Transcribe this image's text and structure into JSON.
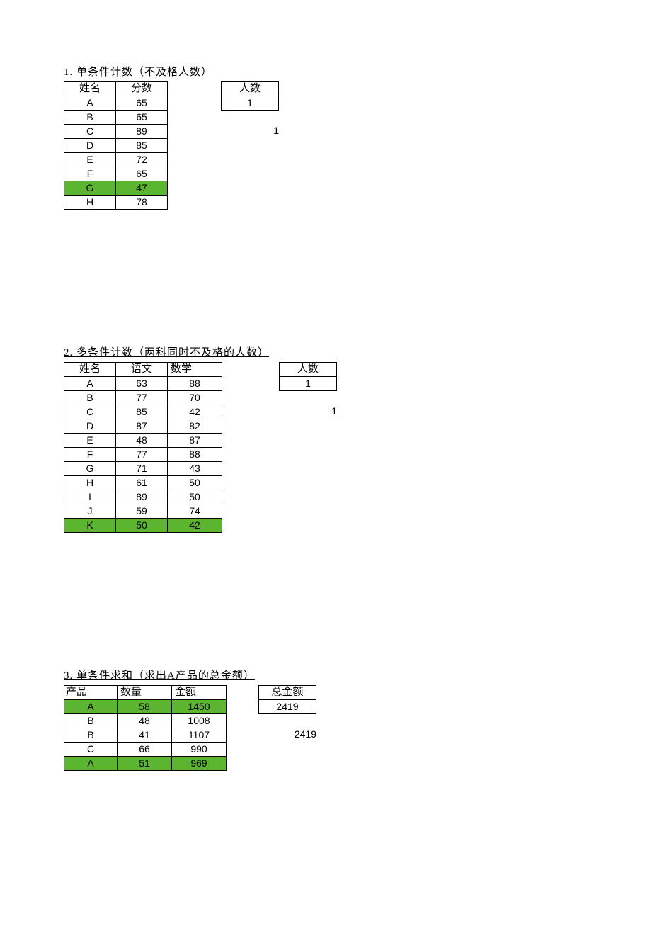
{
  "section1": {
    "title": "1. 单条件计数（不及格人数）",
    "headers": [
      "姓名",
      "分数"
    ],
    "rows": [
      {
        "name": "A",
        "score": "65",
        "hl": false
      },
      {
        "name": "B",
        "score": "65",
        "hl": false
      },
      {
        "name": "C",
        "score": "89",
        "hl": false
      },
      {
        "name": "D",
        "score": "85",
        "hl": false
      },
      {
        "name": "E",
        "score": "72",
        "hl": false
      },
      {
        "name": "F",
        "score": "65",
        "hl": false
      },
      {
        "name": "G",
        "score": "47",
        "hl": true
      },
      {
        "name": "H",
        "score": "78",
        "hl": false
      }
    ],
    "result_header": "人数",
    "result_value": "1",
    "below_value": "1"
  },
  "section2": {
    "title": "2. 多条件计数（两科同时不及格的人数）",
    "headers": [
      "姓名",
      "语文",
      "数学"
    ],
    "rows": [
      {
        "name": "A",
        "yw": "63",
        "sx": "88",
        "hl": false
      },
      {
        "name": "B",
        "yw": "77",
        "sx": "70",
        "hl": false
      },
      {
        "name": "C",
        "yw": "85",
        "sx": "42",
        "hl": false
      },
      {
        "name": "D",
        "yw": "87",
        "sx": "82",
        "hl": false
      },
      {
        "name": "E",
        "yw": "48",
        "sx": "87",
        "hl": false
      },
      {
        "name": "F",
        "yw": "77",
        "sx": "88",
        "hl": false
      },
      {
        "name": "G",
        "yw": "71",
        "sx": "43",
        "hl": false
      },
      {
        "name": "H",
        "yw": "61",
        "sx": "50",
        "hl": false
      },
      {
        "name": "I",
        "yw": "89",
        "sx": "50",
        "hl": false
      },
      {
        "name": "J",
        "yw": "59",
        "sx": "74",
        "hl": false
      },
      {
        "name": "K",
        "yw": "50",
        "sx": "42",
        "hl": true
      }
    ],
    "result_header": "人数",
    "result_value": "1",
    "below_value": "1"
  },
  "section3": {
    "title": "3. 单条件求和（求出A产品的总金额）",
    "headers": [
      "产品",
      "数量",
      "金额"
    ],
    "rows": [
      {
        "prod": "A",
        "qty": "58",
        "amt": "1450",
        "hl": true
      },
      {
        "prod": "B",
        "qty": "48",
        "amt": "1008",
        "hl": false
      },
      {
        "prod": "B",
        "qty": "41",
        "amt": "1107",
        "hl": false
      },
      {
        "prod": "C",
        "qty": "66",
        "amt": "990",
        "hl": false
      },
      {
        "prod": "A",
        "qty": "51",
        "amt": "969",
        "hl": true
      }
    ],
    "result_header": "总金额",
    "result_value": "2419",
    "below_value": "2419"
  }
}
